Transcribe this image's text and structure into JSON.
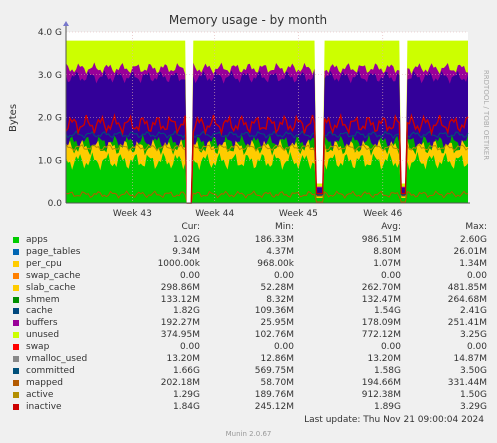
{
  "chart_data": {
    "type": "area",
    "title": "Memory usage - by month",
    "ylabel": "Bytes",
    "watermark": "RRDTOOL / TOBI OETIKER",
    "ylim": [
      0,
      4.0
    ],
    "y_ticks": [
      "0.0",
      "1.0 G",
      "2.0 G",
      "3.0 G",
      "4.0 G"
    ],
    "x_ticks": [
      "Week 43",
      "Week 44",
      "Week 45",
      "Week 46"
    ],
    "stack_top_level": 3.8,
    "series": [
      {
        "name": "apps",
        "color": "#00cc00",
        "level": 0.98
      },
      {
        "name": "page_tables",
        "color": "#0066b3",
        "level": 1.0
      },
      {
        "name": "per_cpu",
        "color": "#ffcc00",
        "level": 1.0
      },
      {
        "name": "swap_cache",
        "color": "#ff8000",
        "level": 1.0
      },
      {
        "name": "slab_cache",
        "color": "#ffcc00",
        "level": 1.3
      },
      {
        "name": "shmem",
        "color": "#00aa00",
        "level": 1.42
      },
      {
        "name": "cache",
        "color": "#330099",
        "level": 2.95
      },
      {
        "name": "buffers",
        "color": "#990099",
        "level": 3.15
      },
      {
        "name": "unused",
        "color": "#ccff00",
        "level": 3.8
      },
      {
        "name": "swap",
        "color": "#ff0000",
        "level": 3.8
      },
      {
        "name": "vmalloc_used",
        "color": "#888888",
        "level": 0.0132
      },
      {
        "name": "committed",
        "color": "#00507a",
        "level": 1.6
      },
      {
        "name": "mapped",
        "color": "#b35a00",
        "level": 0.2
      },
      {
        "name": "active",
        "color": "#b38f00",
        "level": 1.3
      },
      {
        "name": "inactive",
        "color": "#cc0000",
        "level": 1.84
      }
    ],
    "gaps": [
      {
        "label": "Week 44"
      },
      {
        "label": "Week 45 dip"
      },
      {
        "label": "Week 46 dip"
      }
    ]
  },
  "legend": {
    "headers": {
      "cur": "Cur:",
      "min": "Min:",
      "avg": "Avg:",
      "max": "Max:"
    },
    "rows": [
      {
        "name": "apps",
        "color": "#00cc00",
        "cur": "1.02G",
        "min": "186.33M",
        "avg": "986.51M",
        "max": "2.60G"
      },
      {
        "name": "page_tables",
        "color": "#0066b3",
        "cur": "9.34M",
        "min": "4.37M",
        "avg": "8.80M",
        "max": "26.01M"
      },
      {
        "name": "per_cpu",
        "color": "#ffcc00",
        "cur": "1000.00k",
        "min": "968.00k",
        "avg": "1.07M",
        "max": "1.34M"
      },
      {
        "name": "swap_cache",
        "color": "#ff8000",
        "cur": "0.00",
        "min": "0.00",
        "avg": "0.00",
        "max": "0.00"
      },
      {
        "name": "slab_cache",
        "color": "#ffcc00",
        "cur": "298.86M",
        "min": "52.28M",
        "avg": "262.70M",
        "max": "481.85M"
      },
      {
        "name": "shmem",
        "color": "#008f00",
        "cur": "133.12M",
        "min": "8.32M",
        "avg": "132.47M",
        "max": "264.68M"
      },
      {
        "name": "cache",
        "color": "#00487d",
        "cur": "1.82G",
        "min": "109.36M",
        "avg": "1.54G",
        "max": "2.41G"
      },
      {
        "name": "buffers",
        "color": "#990099",
        "cur": "192.27M",
        "min": "25.95M",
        "avg": "178.09M",
        "max": "251.41M"
      },
      {
        "name": "unused",
        "color": "#ccff00",
        "cur": "374.95M",
        "min": "102.76M",
        "avg": "772.12M",
        "max": "3.25G"
      },
      {
        "name": "swap",
        "color": "#ff0000",
        "cur": "0.00",
        "min": "0.00",
        "avg": "0.00",
        "max": "0.00"
      },
      {
        "name": "vmalloc_used",
        "color": "#888888",
        "cur": "13.20M",
        "min": "12.86M",
        "avg": "13.20M",
        "max": "14.87M"
      },
      {
        "name": "committed",
        "color": "#00507a",
        "cur": "1.66G",
        "min": "569.75M",
        "avg": "1.58G",
        "max": "3.50G"
      },
      {
        "name": "mapped",
        "color": "#b35a00",
        "cur": "202.18M",
        "min": "58.70M",
        "avg": "194.66M",
        "max": "331.44M"
      },
      {
        "name": "active",
        "color": "#b38f00",
        "cur": "1.29G",
        "min": "189.76M",
        "avg": "912.38M",
        "max": "1.50G"
      },
      {
        "name": "inactive",
        "color": "#cc0000",
        "cur": "1.84G",
        "min": "245.12M",
        "avg": "1.89G",
        "max": "3.29G"
      }
    ]
  },
  "footer": {
    "last_update": "Last update: Thu Nov 21 09:00:04 2024",
    "generator": "Munin 2.0.67"
  }
}
